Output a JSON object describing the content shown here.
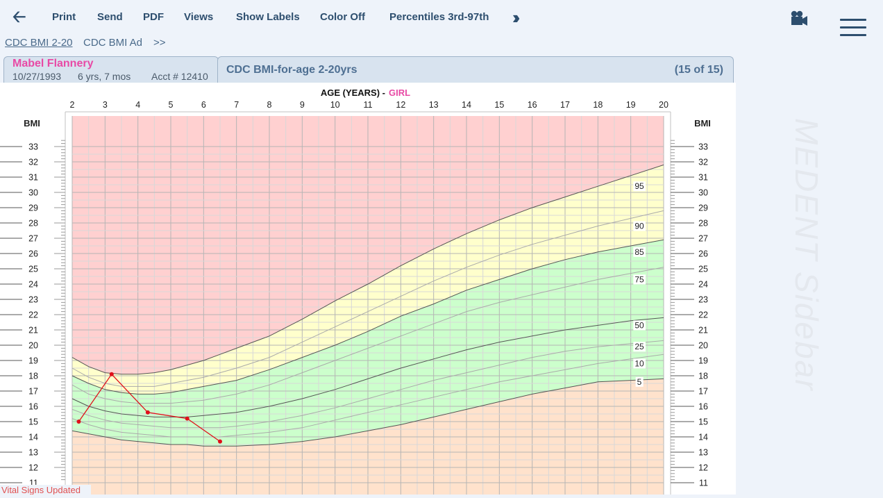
{
  "toolbar": {
    "print": "Print",
    "send": "Send",
    "pdf": "PDF",
    "views": "Views",
    "show_labels": "Show Labels",
    "color_off": "Color Off",
    "percentiles": "Percentiles 3rd-97th",
    "more_icon": "double-chevron-right-icon",
    "back_icon": "back-arrow-icon",
    "camera_icon": "video-camera-icon",
    "menu_icon": "hamburger-menu-icon"
  },
  "subtabs": [
    "CDC BMI 2-20",
    "CDC BMI Ad",
    ">>"
  ],
  "patient": {
    "name": "Mabel Flannery",
    "dob": "10/27/1993",
    "age": "6 yrs, 7 mos",
    "acct": "Acct # 12410"
  },
  "chart_tab": {
    "title": "CDC BMI-for-age 2-20yrs",
    "count": "(15 of 15)"
  },
  "sidebar_label": "MEDENT Sidebar",
  "status": "Vital Signs Updated",
  "colors": {
    "obese": "#ffd0d0",
    "overweight": "#ffffcc",
    "healthy": "#ccffcc",
    "underweight": "#ffe2cc",
    "patient_line": "#e0101a",
    "girl_label": "#e84aa5",
    "grid": "#c8c8c8"
  },
  "chart_data": {
    "type": "line",
    "top_label": "AGE (YEARS)  -",
    "sex": "GIRL",
    "ylabel_left": "BMI",
    "ylabel_right": "BMI",
    "xlim": [
      2,
      20
    ],
    "ylim": [
      11,
      33
    ],
    "x_ticks": [
      2,
      3,
      4,
      5,
      6,
      7,
      8,
      9,
      10,
      11,
      12,
      13,
      14,
      15,
      16,
      17,
      18,
      19,
      20
    ],
    "y_ticks": [
      11,
      12,
      13,
      14,
      15,
      16,
      17,
      18,
      19,
      20,
      21,
      22,
      23,
      24,
      25,
      26,
      27,
      28,
      29,
      30,
      31,
      32,
      33
    ],
    "grid": true,
    "ages": [
      2,
      2.5,
      3,
      3.5,
      4,
      4.5,
      5,
      5.5,
      6,
      6.5,
      7,
      8,
      9,
      10,
      11,
      12,
      13,
      14,
      15,
      16,
      17,
      18,
      19,
      20
    ],
    "percentiles": [
      {
        "name": "95",
        "band_edge": true,
        "values": [
          19.2,
          18.6,
          18.2,
          18.1,
          18.1,
          18.2,
          18.4,
          18.7,
          19.0,
          19.4,
          19.8,
          20.6,
          21.7,
          22.9,
          24.0,
          25.2,
          26.3,
          27.3,
          28.2,
          29.0,
          29.7,
          30.4,
          31.1,
          31.8
        ]
      },
      {
        "name": "90",
        "band_edge": false,
        "values": [
          18.5,
          17.9,
          17.5,
          17.3,
          17.3,
          17.3,
          17.5,
          17.7,
          17.9,
          18.2,
          18.5,
          19.2,
          20.2,
          21.2,
          22.2,
          23.2,
          24.2,
          25.1,
          25.9,
          26.6,
          27.2,
          27.8,
          28.3,
          28.8
        ]
      },
      {
        "name": "85",
        "band_edge": true,
        "values": [
          18.0,
          17.5,
          17.1,
          16.9,
          16.8,
          16.8,
          16.9,
          17.1,
          17.3,
          17.5,
          17.7,
          18.4,
          19.2,
          20.0,
          20.9,
          21.9,
          22.7,
          23.6,
          24.3,
          25.0,
          25.6,
          26.1,
          26.5,
          26.9
        ]
      },
      {
        "name": "75",
        "band_edge": false,
        "values": [
          17.4,
          16.8,
          16.5,
          16.3,
          16.2,
          16.2,
          16.2,
          16.3,
          16.4,
          16.6,
          16.8,
          17.4,
          18.2,
          19.0,
          19.8,
          20.6,
          21.4,
          22.2,
          22.8,
          23.3,
          23.8,
          24.3,
          24.7,
          25.1
        ]
      },
      {
        "name": "50",
        "band_edge": false,
        "values": [
          16.5,
          16.0,
          15.7,
          15.5,
          15.4,
          15.3,
          15.3,
          15.3,
          15.4,
          15.5,
          15.6,
          16.0,
          16.5,
          17.1,
          17.8,
          18.5,
          19.1,
          19.7,
          20.2,
          20.6,
          21.0,
          21.3,
          21.6,
          21.8
        ]
      },
      {
        "name": "25",
        "band_edge": false,
        "values": [
          15.8,
          15.4,
          15.1,
          14.9,
          14.8,
          14.7,
          14.6,
          14.6,
          14.6,
          14.6,
          14.7,
          15.0,
          15.4,
          15.9,
          16.5,
          17.1,
          17.7,
          18.2,
          18.7,
          19.2,
          19.6,
          19.9,
          20.1,
          20.3
        ]
      },
      {
        "name": "10",
        "band_edge": false,
        "values": [
          15.2,
          14.8,
          14.5,
          14.3,
          14.2,
          14.1,
          14.0,
          14.0,
          14.0,
          14.0,
          14.1,
          14.3,
          14.6,
          15.1,
          15.6,
          16.1,
          16.6,
          17.1,
          17.6,
          18.0,
          18.4,
          18.8,
          19.1,
          19.4
        ]
      },
      {
        "name": "5",
        "band_edge": true,
        "values": [
          14.4,
          14.2,
          14.0,
          13.8,
          13.7,
          13.6,
          13.5,
          13.5,
          13.4,
          13.4,
          13.4,
          13.5,
          13.7,
          14.0,
          14.4,
          14.8,
          15.3,
          15.8,
          16.3,
          16.8,
          17.2,
          17.6,
          17.7,
          17.8
        ]
      }
    ],
    "patient": {
      "x": [
        2.2,
        3.2,
        4.3,
        5.5,
        6.5
      ],
      "y": [
        15.0,
        18.1,
        15.6,
        15.2,
        13.7
      ]
    }
  }
}
